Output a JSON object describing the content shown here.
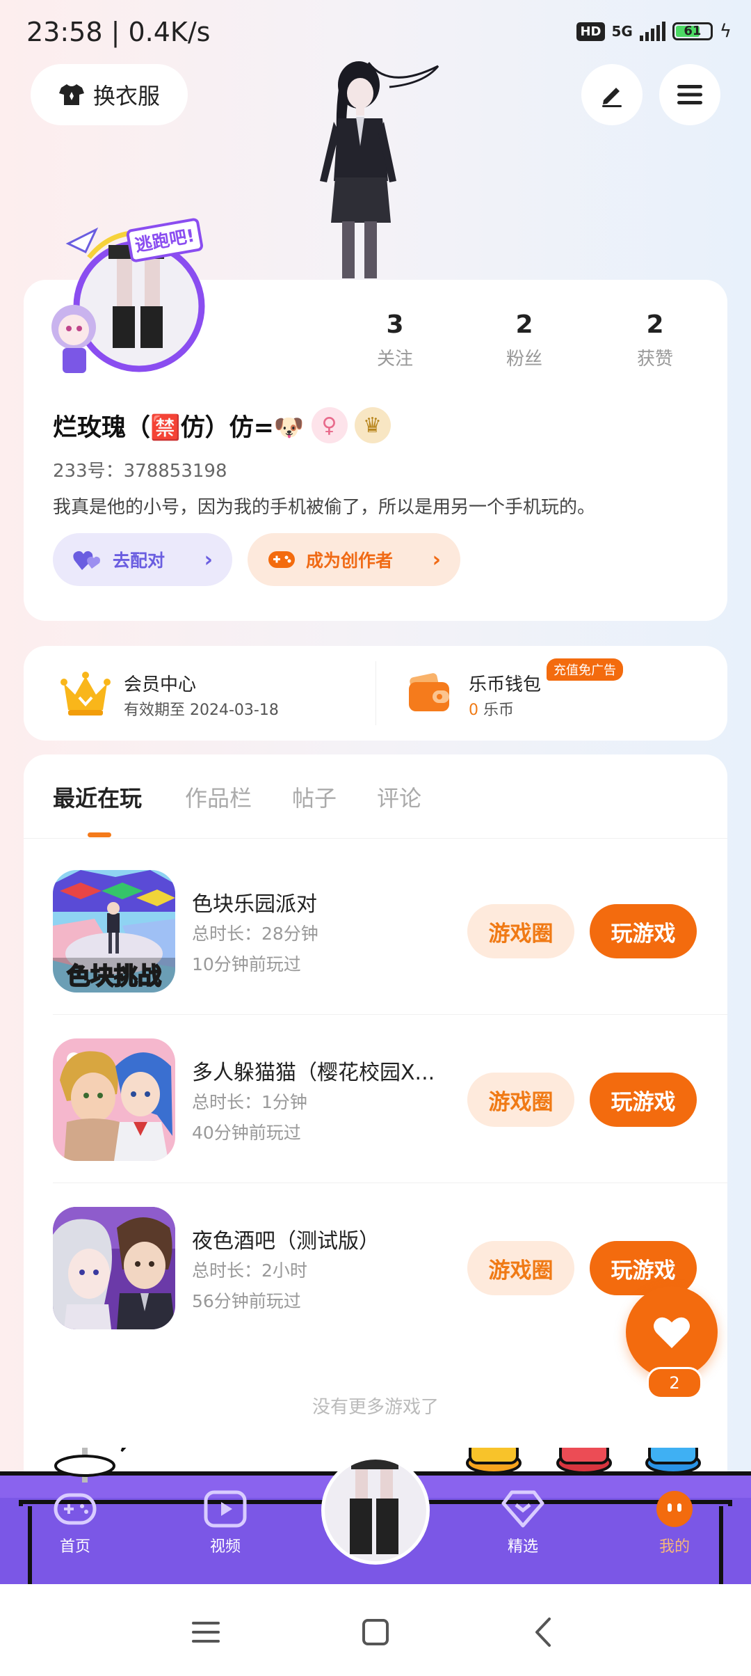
{
  "status_bar": {
    "time_speed": "23:58 | 0.4K/s",
    "hd": "HD",
    "network": "5G",
    "battery": "61"
  },
  "header": {
    "outfit_label": "换衣服"
  },
  "profile": {
    "stats": [
      {
        "value": "3",
        "label": "关注"
      },
      {
        "value": "2",
        "label": "粉丝"
      },
      {
        "value": "2",
        "label": "获赞"
      }
    ],
    "name": "烂玫瑰（🈲仿）仿=🐶",
    "uid": "233号：378853198",
    "bio": "我真是他的小号，因为我的手机被偷了，所以是用另一个手机玩的。",
    "match_label": "去配对",
    "creator_label": "成为创作者",
    "avatar_badge": "逃跑吧!"
  },
  "membership": {
    "vip_title": "会员中心",
    "vip_expiry": "有效期至 2024-03-18",
    "wallet_title": "乐币钱包",
    "wallet_amount": "0",
    "wallet_unit": "乐币",
    "promo_badge": "充值免广告"
  },
  "tabs": [
    {
      "label": "最近在玩",
      "active": true
    },
    {
      "label": "作品栏",
      "active": false
    },
    {
      "label": "帖子",
      "active": false
    },
    {
      "label": "评论",
      "active": false
    }
  ],
  "games": [
    {
      "title": "色块乐园派对",
      "duration": "总时长：28分钟",
      "last_played": "10分钟前玩过",
      "icon_text": "色块挑战",
      "circle_label": "游戏圈",
      "play_label": "玩游戏"
    },
    {
      "title": "多人躲猫猫（樱花校园X...",
      "duration": "总时长：1分钟",
      "last_played": "40分钟前玩过",
      "circle_label": "游戏圈",
      "play_label": "玩游戏"
    },
    {
      "title": "夜色酒吧（测试版）",
      "duration": "总时长：2小时",
      "last_played": "56分钟前玩过",
      "circle_label": "游戏圈",
      "play_label": "玩游戏"
    }
  ],
  "no_more": "没有更多游戏了",
  "like_count": "2",
  "bottom_nav": [
    {
      "label": "首页",
      "icon": "gamepad-icon"
    },
    {
      "label": "视频",
      "icon": "video-icon"
    },
    {
      "label": "精选",
      "icon": "heart-diamond-icon"
    },
    {
      "label": "我的",
      "icon": "profile-face-icon",
      "active": true
    }
  ],
  "colors": {
    "accent": "#f36b0e",
    "accent_light": "#feeadc",
    "match_purple": "#6a5de0",
    "nav_purple": "#7b57e6"
  }
}
